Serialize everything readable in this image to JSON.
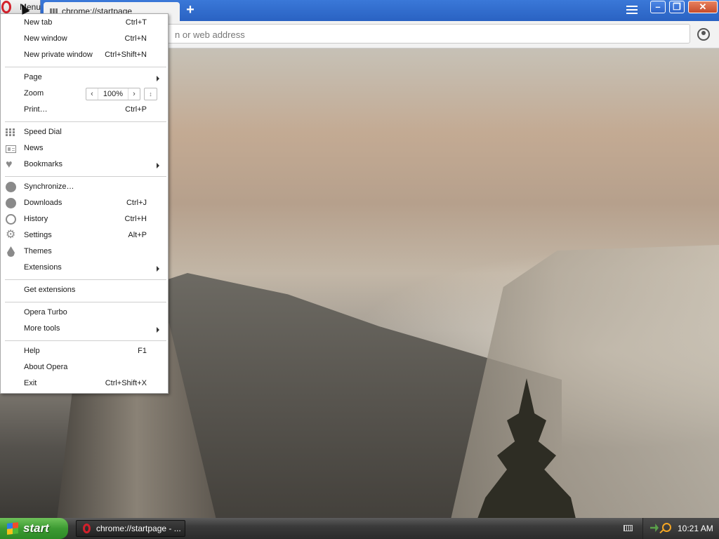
{
  "menu_button": {
    "label": "Menu"
  },
  "tab": {
    "title": "chrome://startpage"
  },
  "address_bar": {
    "placeholder": "n or web address"
  },
  "menu": {
    "new_tab": {
      "label": "New tab",
      "shortcut": "Ctrl+T"
    },
    "new_window": {
      "label": "New window",
      "shortcut": "Ctrl+N"
    },
    "new_private_window": {
      "label": "New private window",
      "shortcut": "Ctrl+Shift+N"
    },
    "page": {
      "label": "Page"
    },
    "zoom": {
      "label": "Zoom",
      "value": "100%"
    },
    "print": {
      "label": "Print…",
      "shortcut": "Ctrl+P"
    },
    "speed_dial": {
      "label": "Speed Dial"
    },
    "news": {
      "label": "News"
    },
    "bookmarks": {
      "label": "Bookmarks"
    },
    "synchronize": {
      "label": "Synchronize…"
    },
    "downloads": {
      "label": "Downloads",
      "shortcut": "Ctrl+J"
    },
    "history": {
      "label": "History",
      "shortcut": "Ctrl+H"
    },
    "settings": {
      "label": "Settings",
      "shortcut": "Alt+P"
    },
    "themes": {
      "label": "Themes"
    },
    "extensions": {
      "label": "Extensions"
    },
    "get_extensions": {
      "label": "Get extensions"
    },
    "opera_turbo": {
      "label": "Opera Turbo"
    },
    "more_tools": {
      "label": "More tools"
    },
    "help": {
      "label": "Help",
      "shortcut": "F1"
    },
    "about": {
      "label": "About Opera"
    },
    "exit": {
      "label": "Exit",
      "shortcut": "Ctrl+Shift+X"
    }
  },
  "taskbar": {
    "start_label": "start",
    "task_label": "chrome://startpage - ...",
    "clock": "10:21 AM"
  },
  "colors": {
    "opera_red": "#d2202b",
    "titlebar_blue": "#2a62c2",
    "start_green": "#3c9a32"
  }
}
